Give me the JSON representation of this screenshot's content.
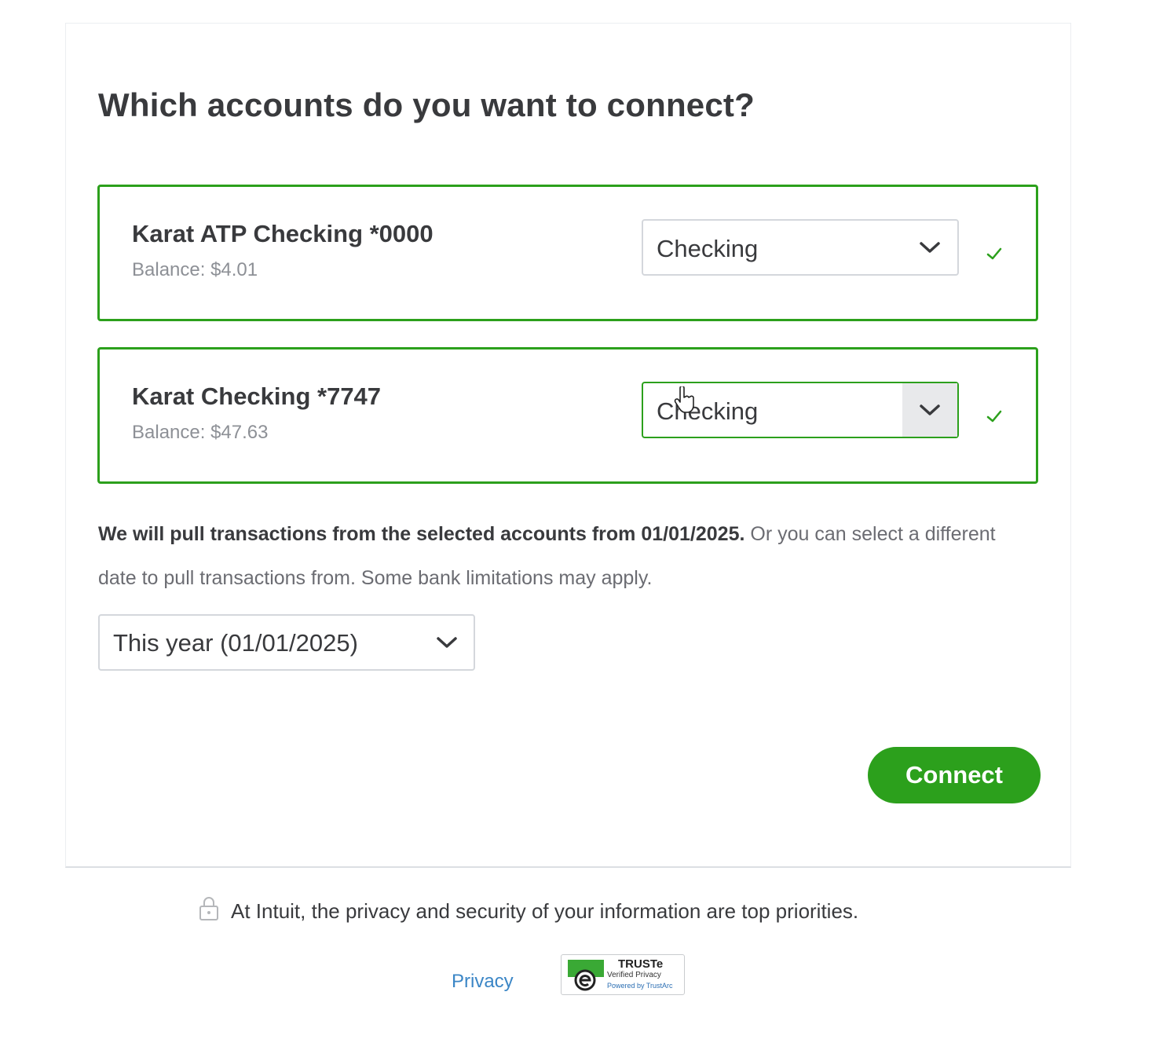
{
  "page": {
    "title": "Which accounts do you want to connect?"
  },
  "accounts": [
    {
      "name": "Karat ATP Checking *0000",
      "balance": "Balance: $4.01",
      "type_selected": "Checking",
      "selected": true
    },
    {
      "name": "Karat Checking *7747",
      "balance": "Balance: $47.63",
      "type_selected": "Checking",
      "selected": true
    }
  ],
  "info": {
    "bold_text": "We will pull transactions from the selected accounts from 01/01/2025.",
    "normal_text": " Or you can select a different date to pull transactions from. Some bank limitations may apply."
  },
  "date_range": {
    "selected": "This year (01/01/2025)"
  },
  "actions": {
    "connect_label": "Connect"
  },
  "footer": {
    "security_text": "At Intuit, the privacy and security of your information are top priorities.",
    "privacy_link": "Privacy",
    "truste_title": "TRUSTe",
    "truste_subtitle": "Verified Privacy",
    "truste_powered": "Powered by TrustArc"
  },
  "icons": {
    "dropdown": "chevron-down-icon",
    "check": "checkmark-icon",
    "lock": "lock-icon",
    "cursor": "hand-pointer-icon"
  },
  "colors": {
    "brand_green": "#2ca01c",
    "text_primary": "#393a3d",
    "text_secondary": "#8d9096",
    "link_blue": "#3b86c6"
  }
}
